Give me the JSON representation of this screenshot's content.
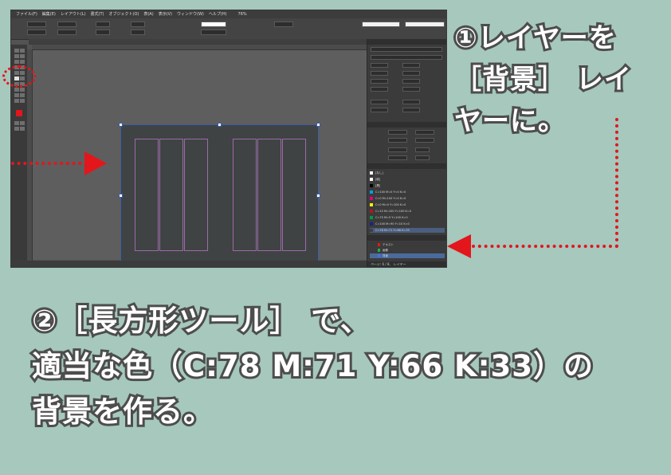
{
  "app": {
    "menu": [
      "ファイル(F)",
      "編集(E)",
      "レイアウト(L)",
      "書式(T)",
      "オブジェクト(O)",
      "表(A)",
      "表示(V)",
      "ウィンドウ(W)",
      "ヘルプ(H)"
    ],
    "zoom": "76%"
  },
  "swatches": [
    {
      "label": "[なし]",
      "color": "#ffffff"
    },
    {
      "label": "[紙]",
      "color": "#ffffff"
    },
    {
      "label": "[黒]",
      "color": "#000000"
    },
    {
      "label": "C=100 M=0 Y=0 K=0",
      "color": "#00a0e9"
    },
    {
      "label": "C=0 M=100 Y=0 K=0",
      "color": "#e4007f"
    },
    {
      "label": "C=0 M=0 Y=100 K=0",
      "color": "#fff100"
    },
    {
      "label": "C=15 M=100 Y=100 K=0",
      "color": "#c30d23"
    },
    {
      "label": "C=75 M=5 Y=100 K=0",
      "color": "#009944"
    },
    {
      "label": "C=100 M=90 Y=10 K=0",
      "color": "#1d2088"
    },
    {
      "label": "C=78 M=71 Y=66 K=33",
      "color": "#3e3f43"
    }
  ],
  "layers": [
    {
      "label": "テキスト",
      "color": "#e3161c"
    },
    {
      "label": "画像",
      "color": "#1bb34a"
    },
    {
      "label": "背景",
      "color": "#4a6ee0"
    }
  ],
  "panels": {
    "page_status": "ページ: 6 / 8、 レイヤー"
  },
  "captions": {
    "step1": "①レイヤーを\n［背景］ レイ\nヤーに。",
    "step2": "②［長方形ツール］ で、\n適当な色（C:78 M:71 Y:66 K:33）の\n背景を作る。"
  },
  "colors": {
    "background": "#a6c8bd",
    "accent_red": "#e3161c",
    "caption_stroke": "#4d4d4d"
  }
}
